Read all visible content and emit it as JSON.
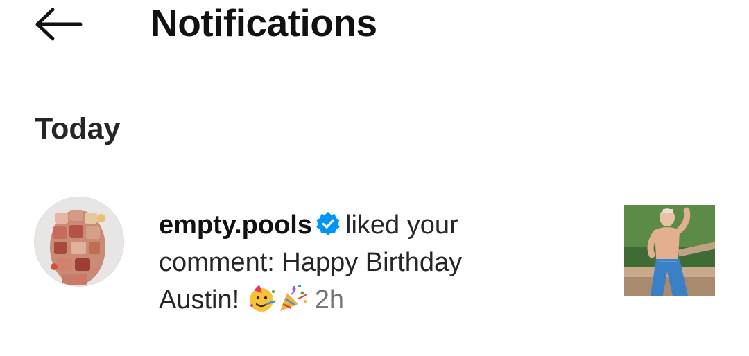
{
  "header": {
    "back_icon": "arrow-left-icon",
    "title": "Notifications"
  },
  "sections": [
    {
      "heading": "Today",
      "items": [
        {
          "username": "empty.pools",
          "verified_icon": "verified-badge-icon",
          "action_text": "liked your comment: Happy Birthday Austin!",
          "emojis": [
            "partying-face-emoji",
            "party-popper-emoji"
          ],
          "time": "2h",
          "avatar_icon": "user-avatar",
          "thumbnail_icon": "post-thumbnail"
        }
      ]
    }
  ],
  "colors": {
    "verified_blue": "#0095f6",
    "text_primary": "#262626",
    "text_secondary": "#737373"
  }
}
